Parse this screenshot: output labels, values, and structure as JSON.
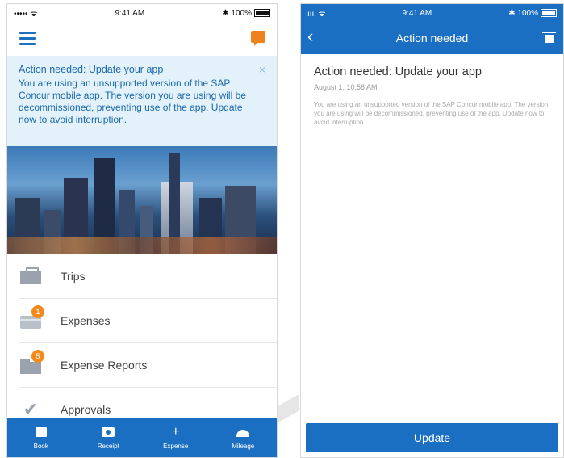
{
  "left": {
    "status": {
      "carrier": "••••• ᯤ",
      "time": "9:41 AM",
      "battery": "✱ 100%"
    },
    "banner": {
      "title": "Action needed: Update your app",
      "text": "You are using an unsupported version of the SAP Concur mobile app. The version you are using will be decommissioned, preventing use of the app. Update now to avoid interruption.",
      "close": "×"
    },
    "menu": [
      {
        "label": "Trips",
        "icon": "briefcase-icon"
      },
      {
        "label": "Expenses",
        "icon": "wallet-icon",
        "badge": "1"
      },
      {
        "label": "Expense Reports",
        "icon": "folder-icon",
        "badge": "5"
      },
      {
        "label": "Approvals",
        "icon": "checkmark-icon"
      }
    ],
    "tabs": [
      {
        "label": "Book",
        "icon": "briefcase-icon"
      },
      {
        "label": "Receipt",
        "icon": "camera-icon"
      },
      {
        "label": "Expense",
        "icon": "plus-icon"
      },
      {
        "label": "Mileage",
        "icon": "gauge-icon"
      }
    ]
  },
  "right": {
    "status": {
      "carrier": "ıııl ᯤ",
      "time": "9:41 AM",
      "battery": "✱ 100%"
    },
    "header_title": "Action needed",
    "detail": {
      "title": "Action needed: Update your app",
      "date": "August 1, 10:58 AM",
      "body": "You are using an unsupported version of the SAP Concur mobile app. The version you are using will be decommissioned, preventing use of the app. Update now to avoid interruption."
    },
    "update_label": "Update"
  },
  "colors": {
    "brand_blue": "#1b6fc2",
    "badge_orange": "#f08a1c",
    "banner_bg": "#e3f1fb"
  }
}
